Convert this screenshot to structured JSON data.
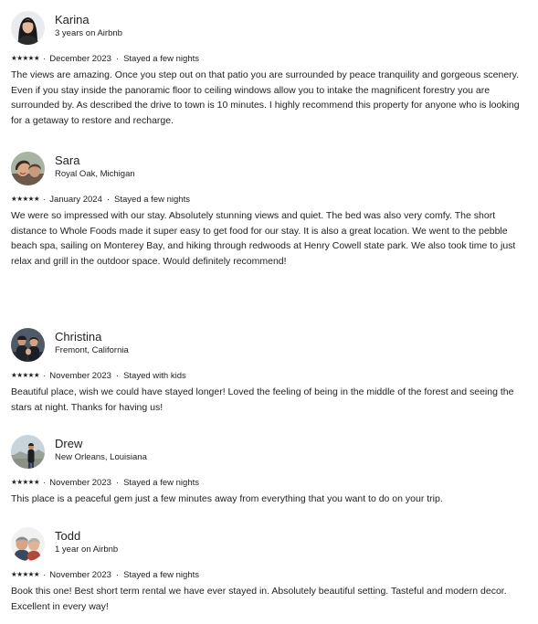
{
  "reviews": [
    {
      "name": "Karina",
      "subtitle": "3 years on Airbnb",
      "stars": "★★★★★",
      "date": "December 2023",
      "stay": "Stayed a few nights",
      "text": "The views are amazing. Once you step out on that patio you are surrounded by peace tranquility and gorgeous scenery. Even if you stay inside the panoramic floor to ceiling windows allow you to intake the magnificent forestry you are surrounded by. As described the drive to town is 10 minutes. I highly recommend this property for anyone who is looking for a getaway to restore and recharge.",
      "avatar_icon": "woman-portrait-photo"
    },
    {
      "name": "Sara",
      "subtitle": "Royal Oak, Michigan",
      "stars": "★★★★★",
      "date": "January 2024",
      "stay": "Stayed a few nights",
      "text": "We were so impressed with our stay. Absolutely stunning views and quiet. The bed was also very comfy. The short distance to Whole Foods made it super easy to get food for our stay. It is also a great location. We went to the pebble beach spa, sailing on Monterey Bay, and hiking through redwoods at Henry Cowell state park. We also took time to just relax and grill in the outdoor space. Would definitely recommend!",
      "avatar_icon": "couple-selfie-photo"
    },
    {
      "name": "Christina",
      "subtitle": "Fremont, California",
      "stars": "★★★★★",
      "date": "November 2023",
      "stay": "Stayed with kids",
      "text": "Beautiful place, wish we could have stayed longer! Loved the feeling of being in the middle of the forest and seeing the stars at night. Thanks for having us!",
      "avatar_icon": "family-photo"
    },
    {
      "name": "Drew",
      "subtitle": "New Orleans, Louisiana",
      "stars": "★★★★★",
      "date": "November 2023",
      "stay": "Stayed a few nights",
      "text": "This place is a peaceful gem just a few minutes away from everything that you want to do on your trip.",
      "avatar_icon": "person-landscape-photo"
    },
    {
      "name": "Todd",
      "subtitle": "1 year on Airbnb",
      "stars": "★★★★★",
      "date": "November 2023",
      "stay": "Stayed a few nights",
      "text": "Book this one! Best short term rental we have ever stayed in. Absolutely beautiful setting. Tasteful and modern decor. Excellent in every way!",
      "avatar_icon": "couple-photo"
    }
  ]
}
